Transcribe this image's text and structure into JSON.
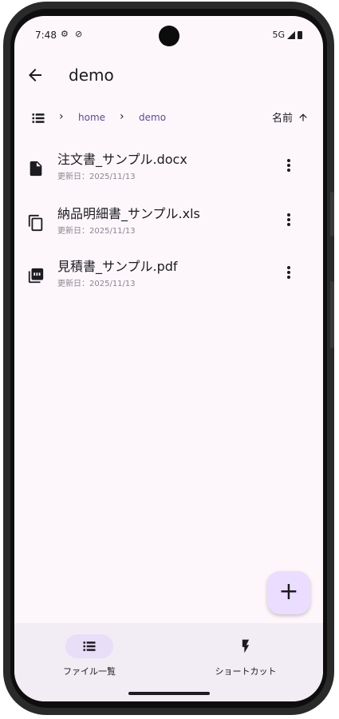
{
  "status_bar": {
    "time": "7:48",
    "network": "5G"
  },
  "app_bar": {
    "title": "demo"
  },
  "breadcrumb": {
    "items": [
      "home",
      "demo"
    ]
  },
  "sort": {
    "label": "名前",
    "direction_icon": "arrow-up-icon"
  },
  "files": [
    {
      "name": "注文書_サンプル.docx",
      "meta": "更新日：2025/11/13",
      "icon": "document-icon"
    },
    {
      "name": "納品明細書_サンプル.xls",
      "meta": "更新日：2025/11/13",
      "icon": "copy-icon"
    },
    {
      "name": "見積書_サンプル.pdf",
      "meta": "更新日：2025/11/13",
      "icon": "pdf-icon"
    }
  ],
  "fab": {
    "label": "+"
  },
  "bottom_nav": {
    "items": [
      {
        "label": "ファイル一覧",
        "icon": "list-icon",
        "active": true
      },
      {
        "label": "ショートカット",
        "icon": "bolt-icon",
        "active": false
      }
    ]
  },
  "colors": {
    "accent": "#5b4d8c",
    "fab_bg": "#eaddff",
    "nav_active": "#e8def8",
    "background": "#fdf7fc"
  }
}
